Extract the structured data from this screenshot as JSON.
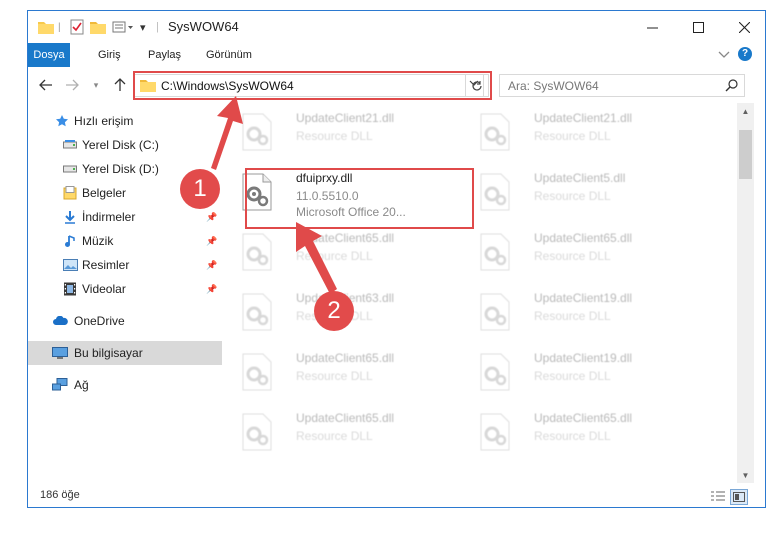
{
  "window": {
    "title": "SysWOW64",
    "controls": {
      "minimize": "—",
      "maximize": "☐",
      "close": "✕"
    }
  },
  "ribbon": {
    "tabs": [
      "Dosya",
      "Giriş",
      "Paylaş",
      "Görünüm"
    ],
    "collapse_icon": "chevron-down-icon",
    "help_icon": "?"
  },
  "navbar": {
    "path": "C:\\Windows\\SysWOW64",
    "search_placeholder": "Ara: SysWOW64"
  },
  "sidebar": {
    "items": [
      {
        "label": "Hızlı erişim",
        "icon": "star-icon"
      },
      {
        "label": "Yerel Disk (C:)",
        "icon": "drive-icon"
      },
      {
        "label": "Yerel Disk (D:)",
        "icon": "drive-icon"
      },
      {
        "label": "Belgeler",
        "icon": "documents-icon"
      },
      {
        "label": "İndirmeler",
        "icon": "download-icon",
        "pinned": true
      },
      {
        "label": "Müzik",
        "icon": "music-icon",
        "pinned": true
      },
      {
        "label": "Resimler",
        "icon": "pictures-icon",
        "pinned": true
      },
      {
        "label": "Videolar",
        "icon": "videos-icon",
        "pinned": true
      },
      {
        "label": "OneDrive",
        "icon": "cloud-icon"
      },
      {
        "label": "Bu bilgisayar",
        "icon": "computer-icon",
        "selected": true
      },
      {
        "label": "Ağ",
        "icon": "network-icon"
      }
    ]
  },
  "files": [
    {
      "name": "UpdateClient21.dll",
      "type": "Resource DLL",
      "faded": true
    },
    {
      "name": "UpdateClient21.dll",
      "type": "Resource DLL",
      "faded": true
    },
    {
      "name": "dfuiprxy.dll",
      "version": "11.0.5510.0",
      "company": "Microsoft Office 20...",
      "faded": false
    },
    {
      "name": "UpdateClient5.dll",
      "type": "Resource DLL",
      "faded": true
    },
    {
      "name": "UpdateClient65.dll",
      "type": "Resource DLL",
      "faded": true
    },
    {
      "name": "UpdateClient65.dll",
      "type": "Resource DLL",
      "faded": true
    },
    {
      "name": "UpdateClient63.dll",
      "type": "Resource DLL",
      "faded": true
    },
    {
      "name": "UpdateClient19.dll",
      "type": "Resource DLL",
      "faded": true
    },
    {
      "name": "UpdateClient65.dll",
      "type": "Resource DLL",
      "faded": true
    },
    {
      "name": "UpdateClient19.dll",
      "type": "Resource DLL",
      "faded": true
    },
    {
      "name": "UpdateClient65.dll",
      "type": "Resource DLL",
      "faded": true
    },
    {
      "name": "UpdateClient65.dll",
      "type": "Resource DLL",
      "faded": true
    }
  ],
  "status": {
    "count": "186 öğe"
  },
  "annotations": {
    "step1": "1",
    "step2": "2",
    "color": "#e04a4a"
  }
}
